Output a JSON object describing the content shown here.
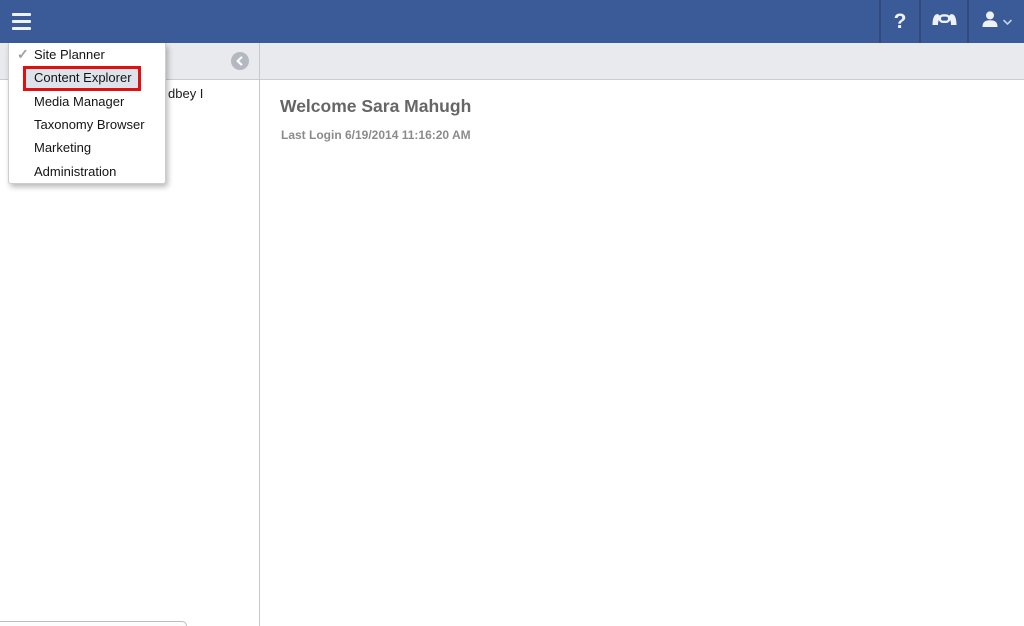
{
  "topbar": {
    "bg_color": "#3b5b98",
    "separator_color": "#33497c",
    "menu_icon": "hamburger-icon",
    "help_glyph": "?",
    "support_icon": "handset-icon",
    "user_icon": "person-icon",
    "user_caret_icon": "chevron-down-icon"
  },
  "app_menu": {
    "check_glyph": "✓",
    "annotation_color": "#e01010",
    "highlight_bg": "#dee3eb",
    "items": [
      {
        "label": "Site Planner",
        "checked": true,
        "highlighted": false
      },
      {
        "label": "Content Explorer",
        "checked": false,
        "highlighted": true
      },
      {
        "label": "Media Manager",
        "checked": false,
        "highlighted": false
      },
      {
        "label": "Taxonomy Browser",
        "checked": false,
        "highlighted": false
      },
      {
        "label": "Marketing",
        "checked": false,
        "highlighted": false
      },
      {
        "label": "Administration",
        "checked": false,
        "highlighted": false
      }
    ]
  },
  "toolbar": {
    "back_icon": "chevron-left-icon",
    "bg_color": "#e8eaee"
  },
  "sidebar": {
    "partial_item_text": "dbey I"
  },
  "main": {
    "welcome_title": "Welcome Sara Mahugh",
    "last_login_text": "Last Login 6/19/2014 11:16:20 AM"
  }
}
